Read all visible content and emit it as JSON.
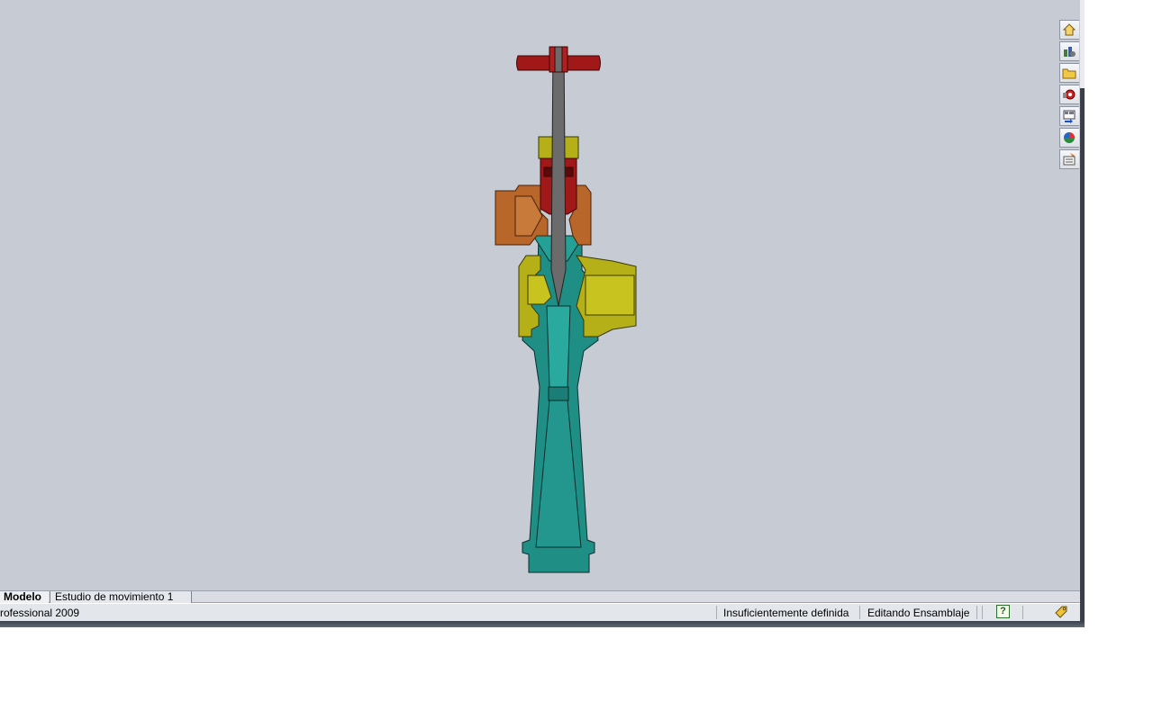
{
  "tabs": [
    {
      "label": "Modelo",
      "active": true
    },
    {
      "label": "Estudio de movimiento 1",
      "active": false
    }
  ],
  "status_bar": {
    "product": "rofessional 2009",
    "definition": "Insuficientemente definida",
    "mode": "Editando Ensamblaje",
    "help_icon_glyph": "?"
  },
  "task_pane": [
    {
      "name": "solidworks-resources-icon"
    },
    {
      "name": "design-library-icon"
    },
    {
      "name": "file-explorer-icon"
    },
    {
      "name": "search-icon"
    },
    {
      "name": "view-palette-icon"
    },
    {
      "name": "appearances-scenes-icon"
    },
    {
      "name": "custom-properties-icon"
    }
  ],
  "colors": {
    "viewport_bg": "#c6cbd4",
    "handle_red": "#a01818",
    "stem_gray": "#6b6b6b",
    "body_olive": "#b5b018",
    "body_copper": "#b8662a",
    "body_teal": "#1f8f86"
  }
}
